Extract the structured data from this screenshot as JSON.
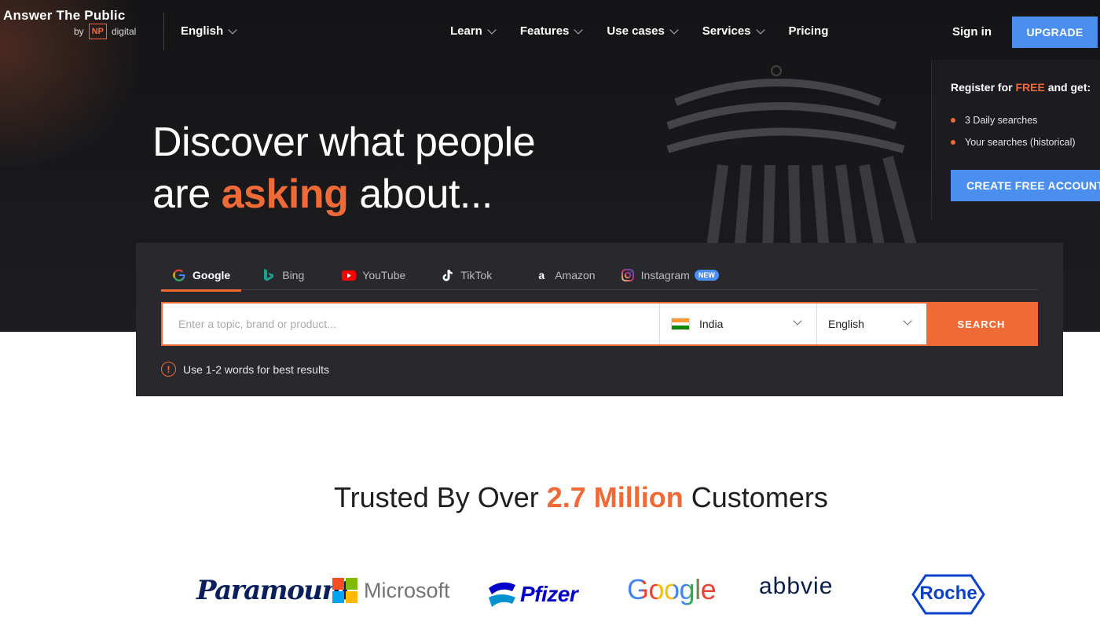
{
  "brand": {
    "title": "Answer The Public",
    "by": "by",
    "np": "NP",
    "digital": "digital"
  },
  "header": {
    "language": "English",
    "nav": [
      "Learn",
      "Features",
      "Use cases",
      "Services",
      "Pricing"
    ],
    "sign_in": "Sign in",
    "upgrade": "UPGRADE"
  },
  "register": {
    "title_pre": "Register for ",
    "title_free": "FREE",
    "title_post": " and get:",
    "items": [
      "3 Daily searches",
      "Your searches (historical)"
    ],
    "cta": "CREATE FREE ACCOUNT"
  },
  "hero": {
    "line1": "Discover what people",
    "line2_pre": "are ",
    "line2_accent": "asking",
    "line2_post": " about..."
  },
  "search": {
    "tabs": [
      "Google",
      "Bing",
      "YouTube",
      "TikTok",
      "Amazon",
      "Instagram"
    ],
    "new_badge": "NEW",
    "placeholder": "Enter a topic, brand or product...",
    "country": "India",
    "language": "English",
    "button": "SEARCH",
    "hint": "Use 1-2 words for best results"
  },
  "trusted": {
    "pre": "Trusted By Over ",
    "accent": "2.7 Million",
    "post": " Customers"
  },
  "logos": [
    "Paramount",
    "Microsoft",
    "Pfizer",
    "Google",
    "abbvie",
    "Roche"
  ],
  "colors": {
    "accent": "#ef6a36",
    "primary_blue": "#4a8ff0",
    "hero_bg": "#1d1d21"
  }
}
